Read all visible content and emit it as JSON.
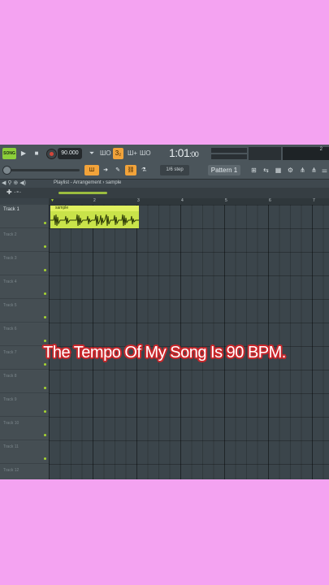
{
  "colors": {
    "background": "#f4a3f1",
    "accent": "#8ccf3a",
    "clip": "#c9e34a",
    "caption_stroke": "#c9272b"
  },
  "transport": {
    "song_label": "SONG",
    "play_icon": "▶",
    "stop_icon": "■",
    "tempo": "90.000",
    "metronome_icon": "⏷",
    "wait_icon": "ШΟ",
    "count_label": "3₂",
    "blend_icon": "Ш+",
    "loop_icon": "ШΟ",
    "time_main": "1:01",
    "time_sub": ":00",
    "mem_label": "2"
  },
  "toolbar2": {
    "snap_label": "Ш",
    "arrow_icon": "➜",
    "pencil_icon": "✎",
    "paint_icon": "⛓",
    "stamp_icon": "⚗",
    "step_label": "1/6 step",
    "pattern_label": "Pattern 1",
    "tool_icons": [
      "⊞",
      "⇆",
      "▦",
      "⚙",
      "⋔",
      "⋔",
      "⚌"
    ]
  },
  "playlist": {
    "breadcrumb": "Playlist - Arrangement › sample",
    "head_icons": "◀ ⚲ ⊕ ◀)",
    "tracks_ctrl": "✚ ·⁃·",
    "ruler": [
      "2",
      "3",
      "4",
      "5",
      "6",
      "7"
    ],
    "tracks": [
      "Track 1",
      "Track 2",
      "Track 3",
      "Track 4",
      "Track 5",
      "Track 6",
      "Track 7",
      "Track 8",
      "Track 9",
      "Track 10",
      "Track 11",
      "Track 12"
    ],
    "clip_name": "sample"
  },
  "caption": "The Tempo Of My Song Is 90 BPM."
}
